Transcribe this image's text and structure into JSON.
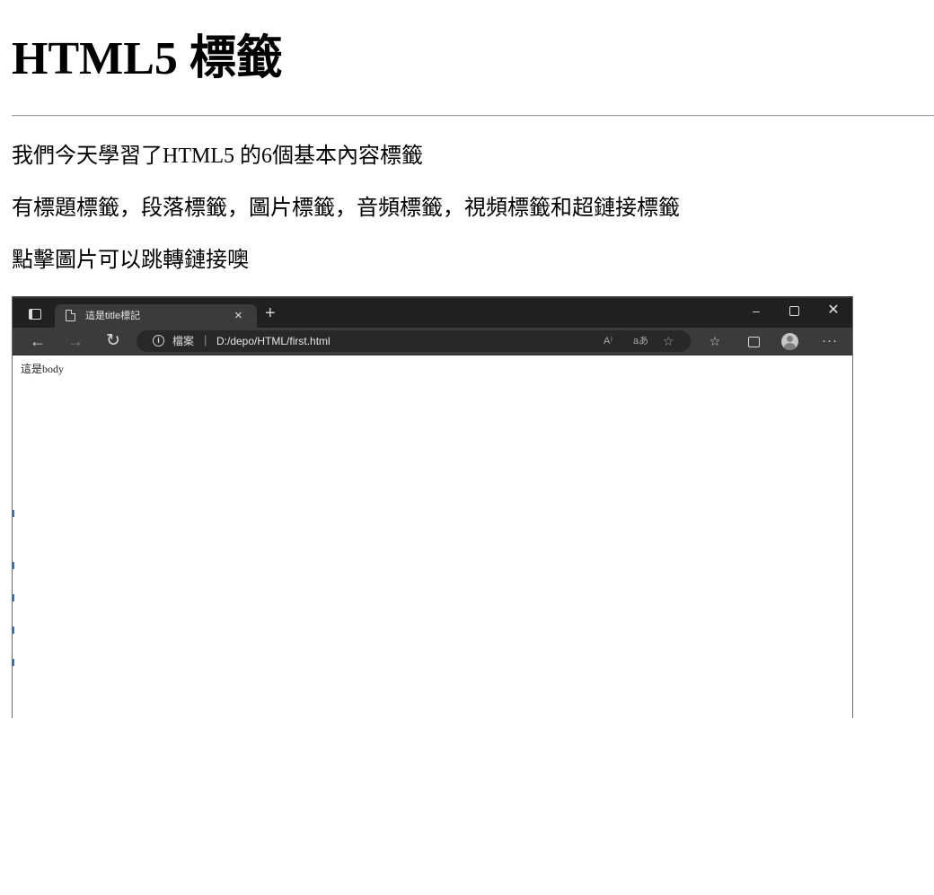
{
  "heading": "HTML5 標籤",
  "paragraphs": [
    "我們今天學習了HTML5 的6個基本內容標籤",
    "有標題標籤，段落標籤，圖片標籤，音頻標籤，視頻標籤和超鏈接標籤",
    "點擊圖片可以跳轉鏈接噢"
  ],
  "screenshot": {
    "browser": {
      "tab_title": "這是title標記",
      "tab_close": "×",
      "new_tab": "+",
      "window_controls": {
        "minimize": "–",
        "close": "✕"
      },
      "nav": {
        "back": "←",
        "forward": "→",
        "reload": "↻"
      },
      "address_bar": {
        "info_glyph": "i",
        "scheme_label": "檔案",
        "separator": "|",
        "url": "D:/depo/HTML/first.html",
        "read_aloud_label": "A⁾",
        "translate_label": "aあ",
        "add_favorite_glyph": "☆"
      },
      "toolbar": {
        "favorites_glyph": "☆",
        "more_glyph": "···"
      },
      "icons": [
        "tab-actions-icon",
        "file-icon",
        "info-icon",
        "read-aloud-icon",
        "translate-icon",
        "add-favorite-icon",
        "favorites-icon",
        "collections-icon",
        "profile-icon",
        "more-icon"
      ]
    },
    "page_content": "這是body"
  },
  "colors": {
    "titlebar": "#202020",
    "active_tab": "#3b3b3b",
    "toolbar": "#3b3b3b",
    "address_bar": "#282828"
  }
}
